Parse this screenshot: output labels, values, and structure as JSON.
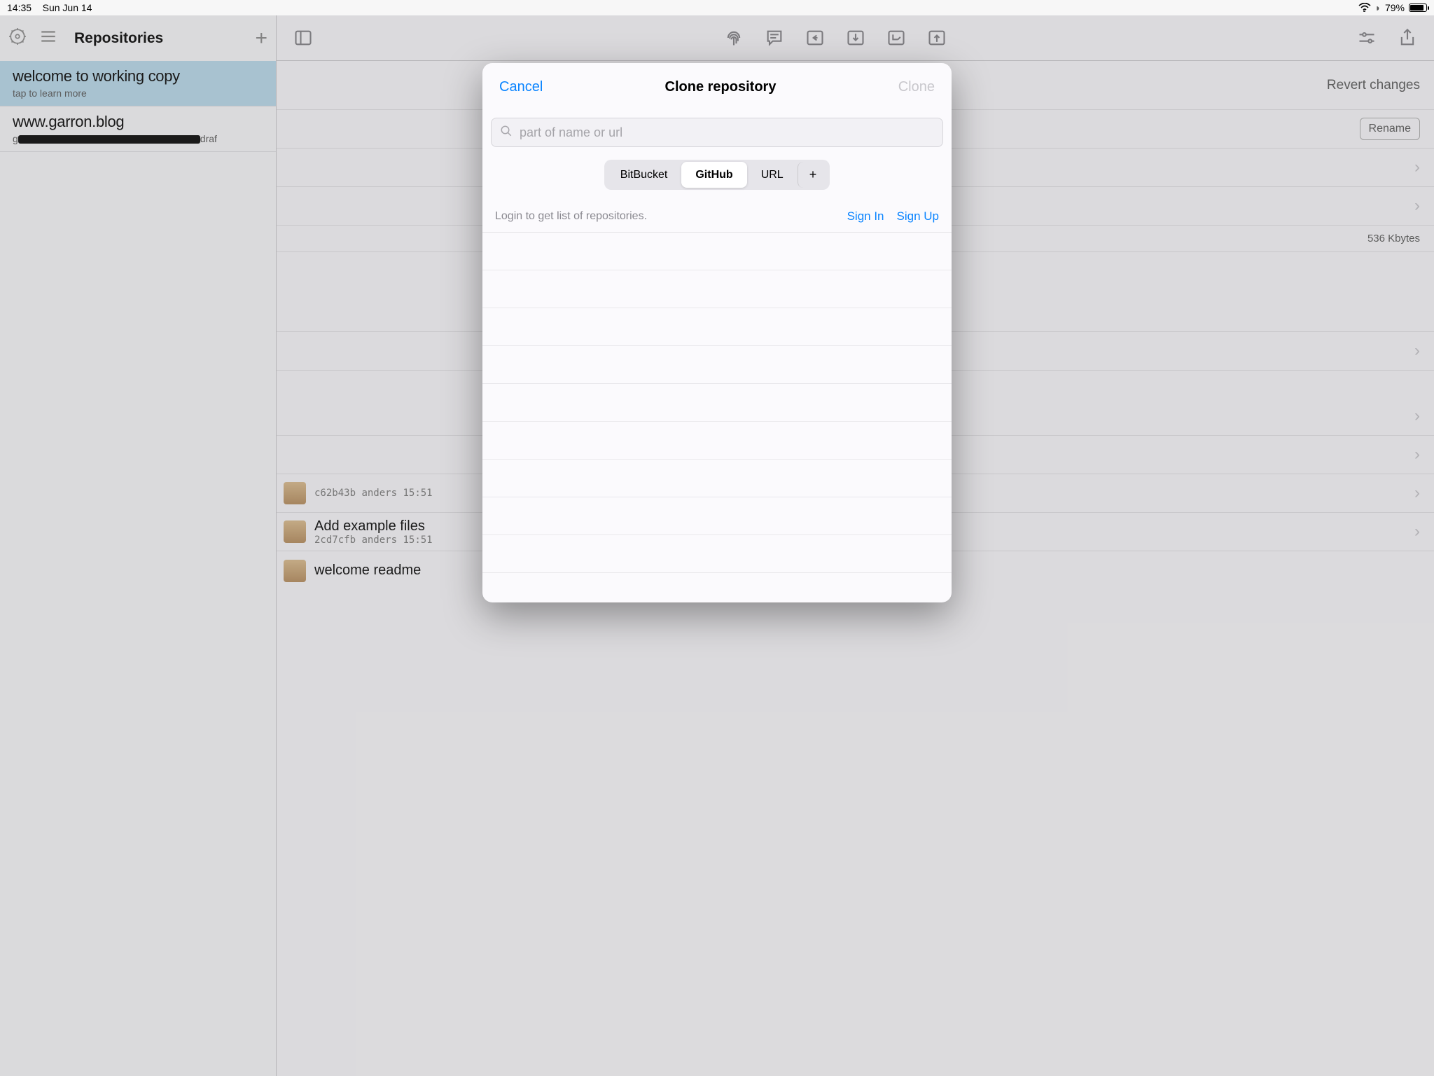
{
  "statusbar": {
    "time": "14:35",
    "date": "Sun Jun 14",
    "battery": "79%"
  },
  "sidebar": {
    "title": "Repositories",
    "items": [
      {
        "title": "welcome to working copy",
        "subtitle": "tap to learn more",
        "selected": true
      },
      {
        "title": "www.garron.blog",
        "subtitle_suffix": "draf",
        "selected": false
      }
    ]
  },
  "main": {
    "header": {
      "revert": "Revert changes",
      "rename": "Rename"
    },
    "size": "536 Kbytes",
    "commits": [
      {
        "title_hash_prefix": "c62b43b",
        "author": "anders",
        "time": "15:51"
      },
      {
        "title": "Add example files",
        "hash": "2cd7cfb",
        "author": "anders",
        "time": "15:51"
      },
      {
        "title": "welcome readme"
      }
    ]
  },
  "modal": {
    "cancel": "Cancel",
    "title": "Clone repository",
    "clone": "Clone",
    "search_placeholder": "part of name or url",
    "tabs": {
      "bitbucket": "BitBucket",
      "github": "GitHub",
      "url": "URL",
      "plus": "+"
    },
    "login_msg": "Login to get list of repositories.",
    "sign_in": "Sign In",
    "sign_up": "Sign Up"
  }
}
